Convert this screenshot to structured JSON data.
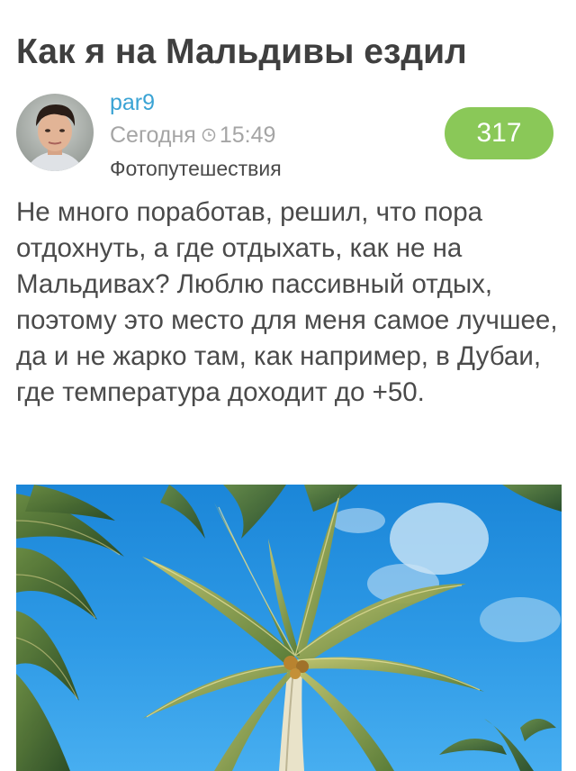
{
  "post": {
    "title": "Как я на Мальдивы ездил",
    "author": "par9",
    "date_label": "Сегодня",
    "time": "15:49",
    "category": "Фотопутешествия",
    "rating": "317",
    "body": "Не много поработав, решил, что пора отдохнуть, а где отдыхать, как не на Мальдивах? Люблю пассивный отдых, поэтому это место для меня самое лучшее, да и не жарко там, как например, в Дубаи, где температура доходит до +50."
  },
  "icons": {
    "clock": "clock-icon"
  },
  "colors": {
    "title": "#3f3f3f",
    "author_link": "#3aa3d4",
    "meta": "#a5a5a5",
    "rating_badge": "#8ac858",
    "body_text": "#4a4a4a"
  }
}
